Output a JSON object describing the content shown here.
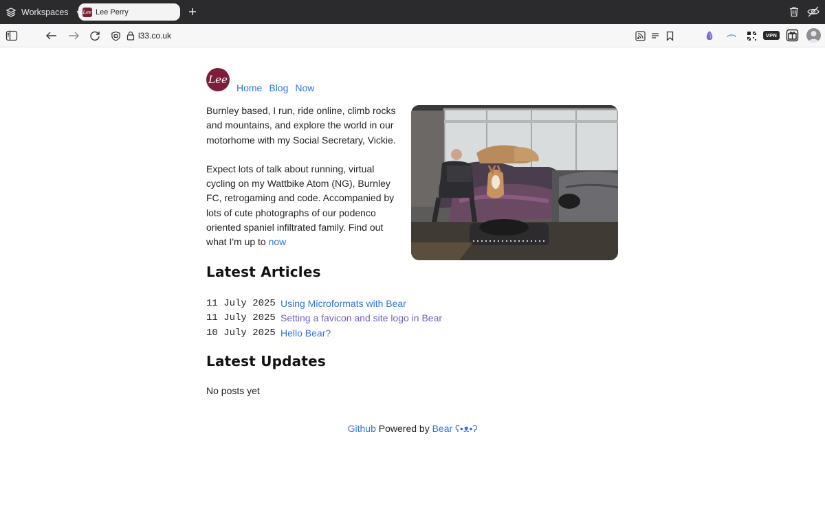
{
  "browser": {
    "workspaces_label": "Workspaces",
    "tab_title": "Lee Perry",
    "tab_favicon_text": "Lee",
    "url": "l33.co.uk",
    "vpn_label": "VPN",
    "icons": [
      "sidebar-toggle-icon",
      "back-arrow-icon",
      "forward-arrow-icon",
      "reload-icon",
      "shield-icon",
      "lock-icon",
      "rss-icon",
      "reader-mode-icon",
      "bookmark-icon",
      "extension-icon",
      "cloud-icon",
      "qr-icon",
      "gift-icon",
      "trash-icon",
      "eye-off-icon"
    ]
  },
  "site": {
    "logo_text": "Lee",
    "nav": [
      "Home",
      "Blog",
      "Now"
    ],
    "intro_p1": "Burnley based, I run, ride online, climb rocks and mountains, and explore the world in our motorhome with my Social Secretary, Vickie.",
    "intro_p2": "Expect lots of talk about running, virtual cycling on my Wattbike Atom (NG), Burnley FC, retrogaming and code. Accompanied by lots of cute photographs of our podenco oriented spaniel infiltrated family. Find out what I'm up to",
    "intro_link": "now",
    "latest_articles_heading": "Latest Articles",
    "articles": [
      {
        "date": "11 July 2025",
        "title": "Using Microformats with Bear"
      },
      {
        "date": "11 July 2025",
        "title": "Setting a favicon and site logo in Bear"
      },
      {
        "date": "10 July 2025",
        "title": "Hello Bear?"
      }
    ],
    "latest_updates_heading": "Latest Updates",
    "no_posts": "No posts yet",
    "footer": {
      "github": "Github",
      "powered_by": "Powered by",
      "bear": "Bear ʕ•ᴥ•ʔ"
    }
  },
  "colors": {
    "link": "#3273dc",
    "visited_link": "#6f5fbf",
    "logo_bg": "#7c1e3b",
    "tabbar_bg": "#2b2b2d"
  }
}
